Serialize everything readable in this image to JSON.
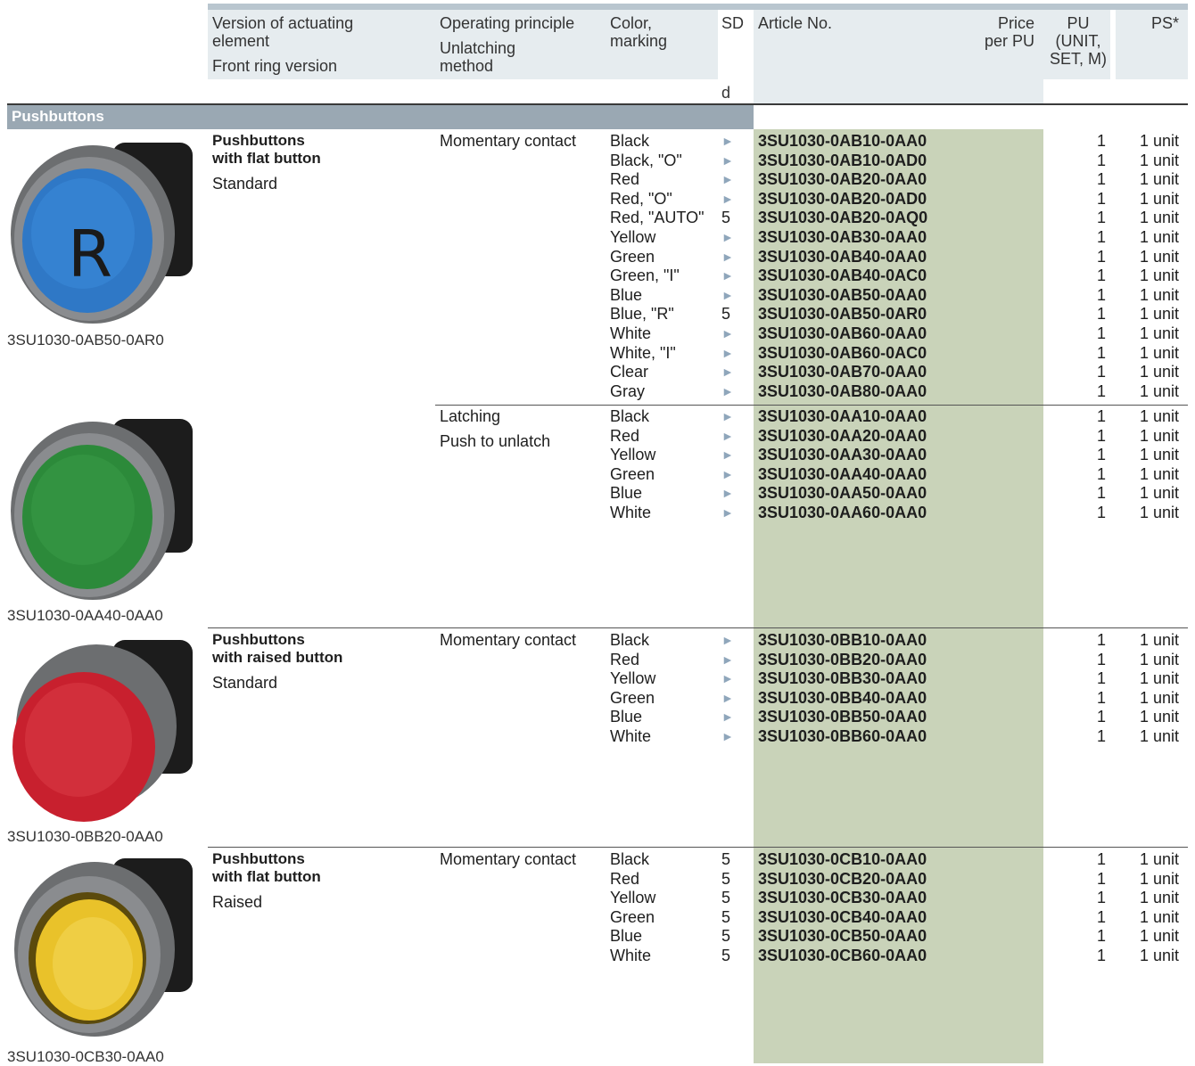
{
  "header": {
    "col1": [
      "Version of actuating",
      "element",
      "Front ring version"
    ],
    "col2": [
      "Operating principle",
      "Unlatching",
      "method"
    ],
    "col3": [
      "Color,",
      "marking"
    ],
    "sd": "SD",
    "sd_sub": "d",
    "article": "Article No.",
    "price": [
      "Price",
      "per PU"
    ],
    "pu": [
      "PU",
      "(UNIT,",
      "SET, M)"
    ],
    "ps": "PS*"
  },
  "section_title": "Pushbuttons",
  "arrow": "►",
  "groups": [
    {
      "title": [
        "Pushbuttons",
        "with flat button"
      ],
      "sub": "Standard",
      "principle": "Momentary contact",
      "principle2": "",
      "image_caption": "3SU1030-0AB50-0AR0",
      "rows": [
        {
          "color": "Black",
          "sd": "►",
          "article": "3SU1030-0AB10-0AA0",
          "pu": "1",
          "ps": "1 unit"
        },
        {
          "color": "Black, \"O\"",
          "sd": "►",
          "article": "3SU1030-0AB10-0AD0",
          "pu": "1",
          "ps": "1 unit"
        },
        {
          "color": "Red",
          "sd": "►",
          "article": "3SU1030-0AB20-0AA0",
          "pu": "1",
          "ps": "1 unit"
        },
        {
          "color": "Red, \"O\"",
          "sd": "►",
          "article": "3SU1030-0AB20-0AD0",
          "pu": "1",
          "ps": "1 unit"
        },
        {
          "color": "Red, \"AUTO\"",
          "sd": "5",
          "article": "3SU1030-0AB20-0AQ0",
          "pu": "1",
          "ps": "1 unit"
        },
        {
          "color": "Yellow",
          "sd": "►",
          "article": "3SU1030-0AB30-0AA0",
          "pu": "1",
          "ps": "1 unit"
        },
        {
          "color": "Green",
          "sd": "►",
          "article": "3SU1030-0AB40-0AA0",
          "pu": "1",
          "ps": "1 unit"
        },
        {
          "color": "Green, \"I\"",
          "sd": "►",
          "article": "3SU1030-0AB40-0AC0",
          "pu": "1",
          "ps": "1 unit"
        },
        {
          "color": "Blue",
          "sd": "►",
          "article": "3SU1030-0AB50-0AA0",
          "pu": "1",
          "ps": "1 unit"
        },
        {
          "color": "Blue, \"R\"",
          "sd": "5",
          "article": "3SU1030-0AB50-0AR0",
          "pu": "1",
          "ps": "1 unit"
        },
        {
          "color": "White",
          "sd": "►",
          "article": "3SU1030-0AB60-0AA0",
          "pu": "1",
          "ps": "1 unit"
        },
        {
          "color": "White, \"I\"",
          "sd": "►",
          "article": "3SU1030-0AB60-0AC0",
          "pu": "1",
          "ps": "1 unit"
        },
        {
          "color": "Clear",
          "sd": "►",
          "article": "3SU1030-0AB70-0AA0",
          "pu": "1",
          "ps": "1 unit"
        },
        {
          "color": "Gray",
          "sd": "►",
          "article": "3SU1030-0AB80-0AA0",
          "pu": "1",
          "ps": "1 unit"
        }
      ]
    },
    {
      "title": [
        "",
        ""
      ],
      "sub": "",
      "principle": "Latching",
      "principle2": "Push to unlatch",
      "image_caption": "3SU1030-0AA40-0AA0",
      "rows": [
        {
          "color": "Black",
          "sd": "►",
          "article": "3SU1030-0AA10-0AA0",
          "pu": "1",
          "ps": "1 unit"
        },
        {
          "color": "Red",
          "sd": "►",
          "article": "3SU1030-0AA20-0AA0",
          "pu": "1",
          "ps": "1 unit"
        },
        {
          "color": "Yellow",
          "sd": "►",
          "article": "3SU1030-0AA30-0AA0",
          "pu": "1",
          "ps": "1 unit"
        },
        {
          "color": "Green",
          "sd": "►",
          "article": "3SU1030-0AA40-0AA0",
          "pu": "1",
          "ps": "1 unit"
        },
        {
          "color": "Blue",
          "sd": "►",
          "article": "3SU1030-0AA50-0AA0",
          "pu": "1",
          "ps": "1 unit"
        },
        {
          "color": "White",
          "sd": "►",
          "article": "3SU1030-0AA60-0AA0",
          "pu": "1",
          "ps": "1 unit"
        }
      ]
    },
    {
      "title": [
        "Pushbuttons",
        "with raised button"
      ],
      "sub": "Standard",
      "principle": "Momentary contact",
      "principle2": "",
      "image_caption": "3SU1030-0BB20-0AA0",
      "rows": [
        {
          "color": "Black",
          "sd": "►",
          "article": "3SU1030-0BB10-0AA0",
          "pu": "1",
          "ps": "1 unit"
        },
        {
          "color": "Red",
          "sd": "►",
          "article": "3SU1030-0BB20-0AA0",
          "pu": "1",
          "ps": "1 unit"
        },
        {
          "color": "Yellow",
          "sd": "►",
          "article": "3SU1030-0BB30-0AA0",
          "pu": "1",
          "ps": "1 unit"
        },
        {
          "color": "Green",
          "sd": "►",
          "article": "3SU1030-0BB40-0AA0",
          "pu": "1",
          "ps": "1 unit"
        },
        {
          "color": "Blue",
          "sd": "►",
          "article": "3SU1030-0BB50-0AA0",
          "pu": "1",
          "ps": "1 unit"
        },
        {
          "color": "White",
          "sd": "►",
          "article": "3SU1030-0BB60-0AA0",
          "pu": "1",
          "ps": "1 unit"
        }
      ]
    },
    {
      "title": [
        "Pushbuttons",
        "with flat button"
      ],
      "sub": "Raised",
      "principle": "Momentary contact",
      "principle2": "",
      "image_caption": "3SU1030-0CB30-0AA0",
      "rows": [
        {
          "color": "Black",
          "sd": "5",
          "article": "3SU1030-0CB10-0AA0",
          "pu": "1",
          "ps": "1 unit"
        },
        {
          "color": "Red",
          "sd": "5",
          "article": "3SU1030-0CB20-0AA0",
          "pu": "1",
          "ps": "1 unit"
        },
        {
          "color": "Yellow",
          "sd": "5",
          "article": "3SU1030-0CB30-0AA0",
          "pu": "1",
          "ps": "1 unit"
        },
        {
          "color": "Green",
          "sd": "5",
          "article": "3SU1030-0CB40-0AA0",
          "pu": "1",
          "ps": "1 unit"
        },
        {
          "color": "Blue",
          "sd": "5",
          "article": "3SU1030-0CB50-0AA0",
          "pu": "1",
          "ps": "1 unit"
        },
        {
          "color": "White",
          "sd": "5",
          "article": "3SU1030-0CB60-0AA0",
          "pu": "1",
          "ps": "1 unit"
        }
      ]
    }
  ],
  "colors": {
    "header_bg": "#e6ecef",
    "section_bar": "#9aa8b3",
    "article_col": "#c9d3b9",
    "arrow": "#8fa6bb"
  },
  "buttons": [
    {
      "cap": "blue",
      "legend": "R"
    },
    {
      "cap": "green",
      "legend": ""
    },
    {
      "cap": "red",
      "legend": ""
    },
    {
      "cap": "yellow",
      "legend": ""
    }
  ]
}
